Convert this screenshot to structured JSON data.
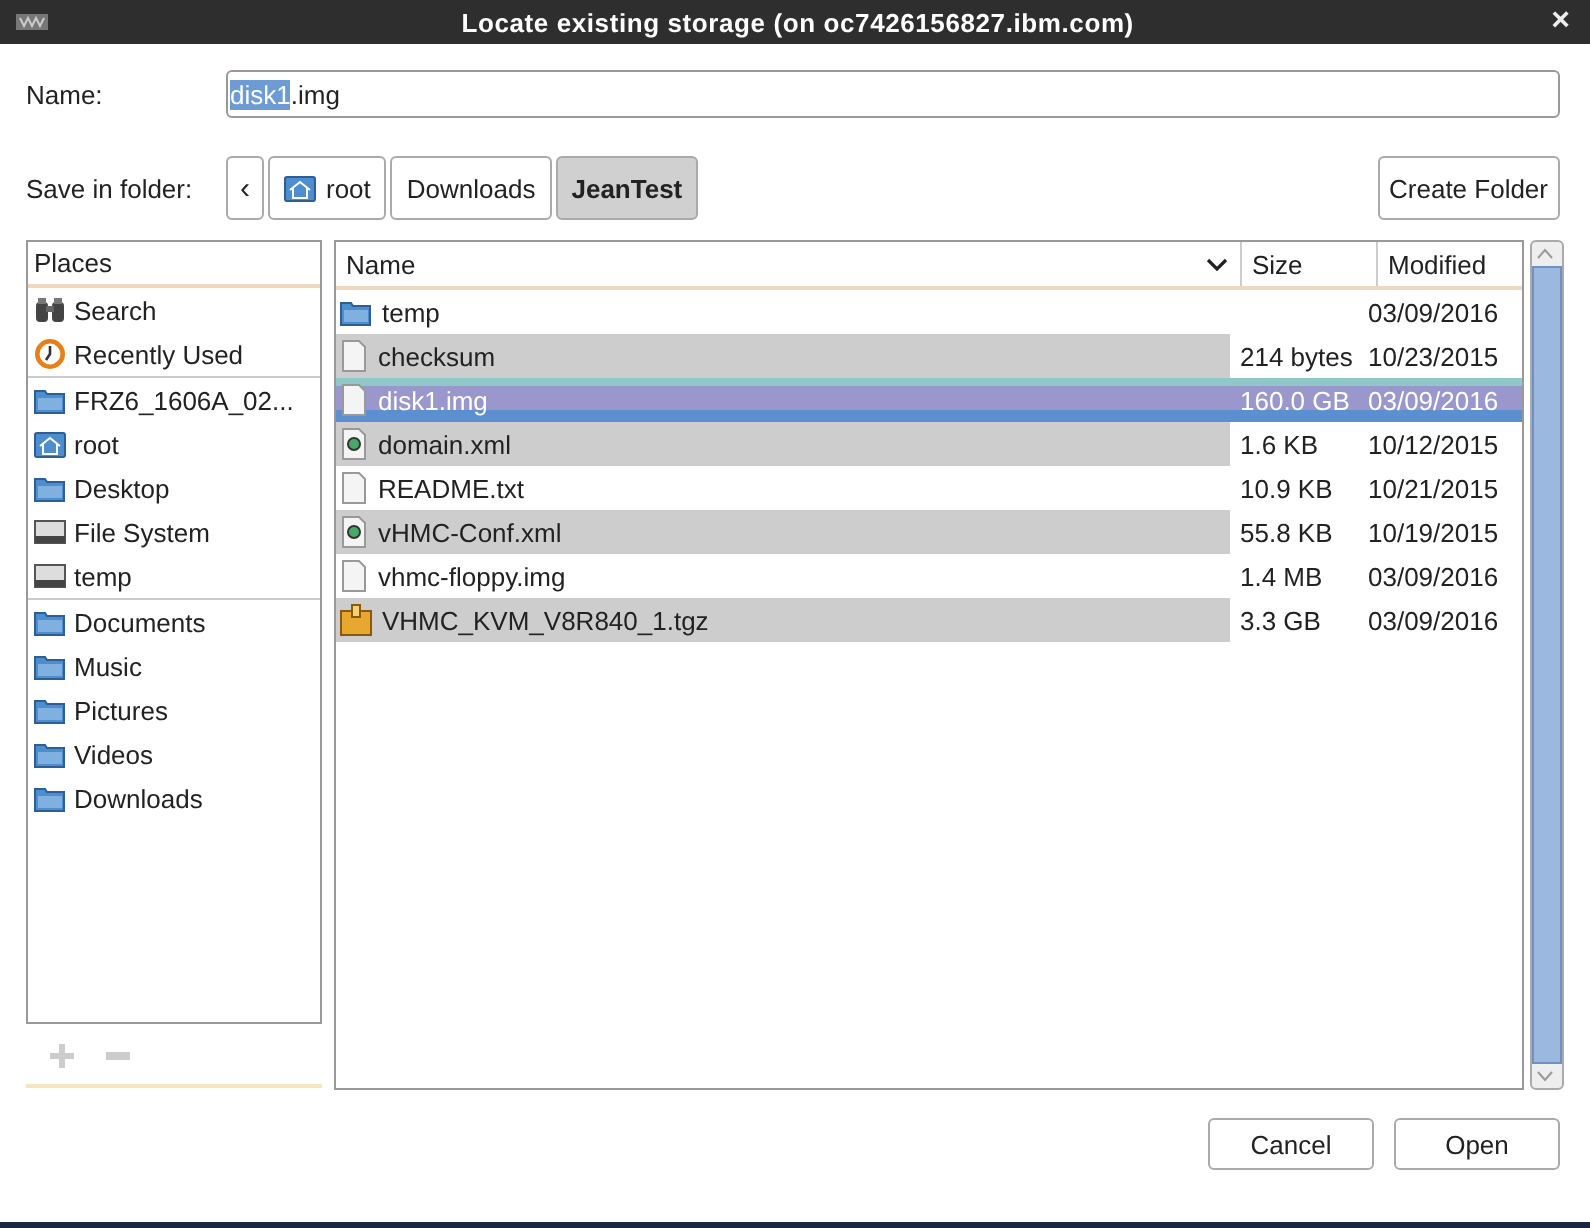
{
  "window": {
    "title": "Locate existing storage (on oc7426156827.ibm.com)",
    "close": "×"
  },
  "name_field": {
    "label": "Name:",
    "selected_text": "disk1",
    "rest_text": ".img"
  },
  "save_in": {
    "label": "Save in folder:",
    "back": "‹",
    "crumbs": [
      {
        "label": "root",
        "kind": "home",
        "selected": false
      },
      {
        "label": "Downloads",
        "kind": "plain",
        "selected": false
      },
      {
        "label": "JeanTest",
        "kind": "plain",
        "selected": true
      }
    ],
    "create_folder": "Create Folder"
  },
  "places": {
    "header": "Places",
    "sections": [
      [
        {
          "label": "Search",
          "kind": "search"
        },
        {
          "label": "Recently Used",
          "kind": "recent"
        }
      ],
      [
        {
          "label": "FRZ6_1606A_02...",
          "kind": "folder"
        },
        {
          "label": "root",
          "kind": "home"
        },
        {
          "label": "Desktop",
          "kind": "folder"
        },
        {
          "label": "File System",
          "kind": "drive"
        },
        {
          "label": "temp",
          "kind": "drive"
        }
      ],
      [
        {
          "label": "Documents",
          "kind": "folder"
        },
        {
          "label": "Music",
          "kind": "folder"
        },
        {
          "label": "Pictures",
          "kind": "folder"
        },
        {
          "label": "Videos",
          "kind": "folder"
        },
        {
          "label": "Downloads",
          "kind": "folder"
        }
      ]
    ]
  },
  "files": {
    "columns": [
      "Name",
      "Size",
      "Modified"
    ],
    "rows": [
      {
        "name": "temp",
        "kind": "folder",
        "size": "",
        "modified": "03/09/2016",
        "selected": false
      },
      {
        "name": "checksum",
        "kind": "file",
        "size": "214 bytes",
        "modified": "10/23/2015",
        "selected": false
      },
      {
        "name": "disk1.img",
        "kind": "file",
        "size": "160.0 GB",
        "modified": "03/09/2016",
        "selected": true
      },
      {
        "name": "domain.xml",
        "kind": "xml",
        "size": "1.6 KB",
        "modified": "10/12/2015",
        "selected": false
      },
      {
        "name": "README.txt",
        "kind": "file",
        "size": "10.9 KB",
        "modified": "10/21/2015",
        "selected": false
      },
      {
        "name": "vHMC-Conf.xml",
        "kind": "xml",
        "size": "55.8 KB",
        "modified": "10/19/2015",
        "selected": false
      },
      {
        "name": "vhmc-floppy.img",
        "kind": "file",
        "size": "1.4 MB",
        "modified": "03/09/2016",
        "selected": false
      },
      {
        "name": "VHMC_KVM_V8R840_1.tgz",
        "kind": "archive",
        "size": "3.3 GB",
        "modified": "03/09/2016",
        "selected": false
      }
    ]
  },
  "buttons": [
    "Cancel",
    "Open"
  ]
}
